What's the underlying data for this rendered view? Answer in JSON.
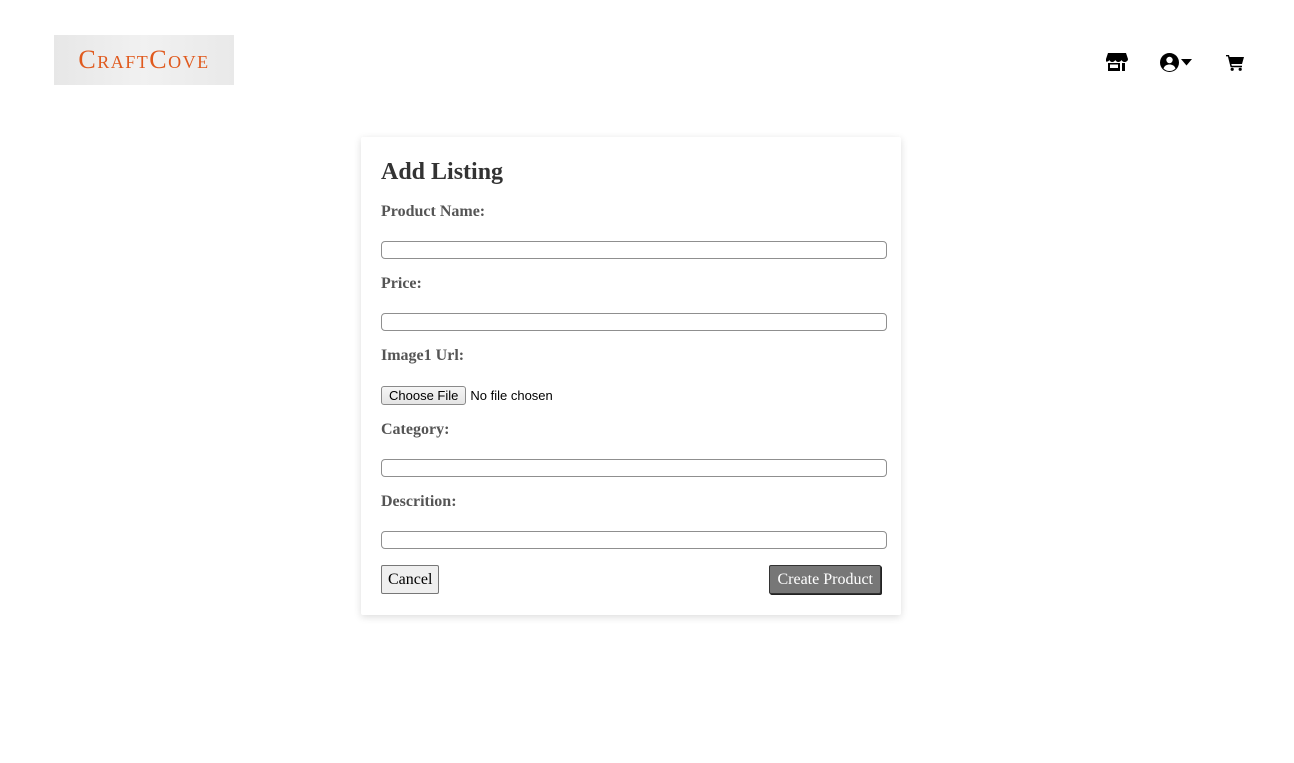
{
  "header": {
    "logo_text": "CraftCove",
    "nav": {
      "store_icon": "store-icon",
      "user_icon": "user-circle-icon",
      "caret_icon": "caret-down-icon",
      "cart_icon": "shopping-cart-icon"
    }
  },
  "form": {
    "title": "Add Listing",
    "fields": {
      "product_name": {
        "label": "Product Name:",
        "value": ""
      },
      "price": {
        "label": "Price:",
        "value": ""
      },
      "image1": {
        "label": "Image1 Url:",
        "button_label": "Choose File",
        "status": "No file chosen"
      },
      "category": {
        "label": "Category:",
        "value": ""
      },
      "description": {
        "label": "Descrition:",
        "value": ""
      }
    },
    "buttons": {
      "cancel": "Cancel",
      "create": "Create Product"
    }
  },
  "colors": {
    "logo_text": "#e05a1e",
    "create_button_bg": "#777777",
    "label_text": "#555555",
    "title_text": "#333333"
  }
}
